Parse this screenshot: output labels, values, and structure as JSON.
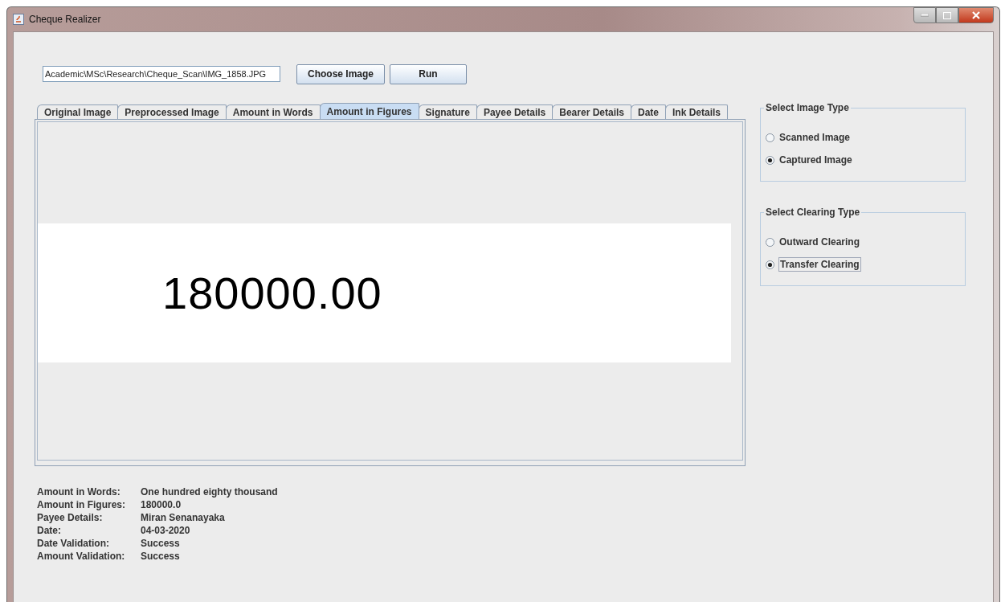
{
  "window": {
    "title": "Cheque Realizer"
  },
  "file_path": {
    "value": "Academic\\MSc\\Research\\Cheque_Scan\\IMG_1858.JPG"
  },
  "buttons": [
    "Choose Image",
    "Run"
  ],
  "tabs": [
    {
      "label": "Original Image",
      "selected": false
    },
    {
      "label": "Preprocessed Image",
      "selected": false
    },
    {
      "label": "Amount in Words",
      "selected": false
    },
    {
      "label": "Amount in Figures",
      "selected": true
    },
    {
      "label": "Signature",
      "selected": false
    },
    {
      "label": "Payee Details",
      "selected": false
    },
    {
      "label": "Bearer Details",
      "selected": false
    },
    {
      "label": "Date",
      "selected": false
    },
    {
      "label": "Ink Details",
      "selected": false
    }
  ],
  "preview": {
    "text": "180000.00"
  },
  "groups": [
    {
      "title": "Select Image Type",
      "options": [
        {
          "label": "Scanned Image",
          "selected": false
        },
        {
          "label": "Captured Image",
          "selected": true
        }
      ]
    },
    {
      "title": "Select Clearing Type",
      "options": [
        {
          "label": "Outward Clearing",
          "selected": false
        },
        {
          "label": "Transfer Clearing",
          "selected": true,
          "focused": true
        }
      ]
    }
  ],
  "results": [
    {
      "label": "Amount in Words:",
      "value": "One hundred eighty thousand"
    },
    {
      "label": "Amount in Figures:",
      "value": "180000.0"
    },
    {
      "label": "Payee Details:",
      "value": "Miran Senanayaka"
    },
    {
      "label": "Date:",
      "value": "04-03-2020"
    },
    {
      "label": "Date Validation:",
      "value": "Success"
    },
    {
      "label": "Amount Validation:",
      "value": "Success"
    }
  ]
}
